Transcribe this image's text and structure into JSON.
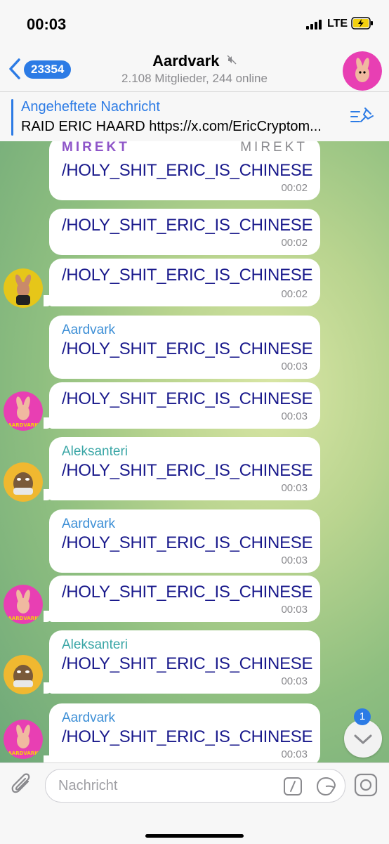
{
  "status_bar": {
    "time": "00:03",
    "network": "LTE"
  },
  "header": {
    "back_count": "23354",
    "title": "Aardvark",
    "subtitle": "2.108 Mitglieder, 244 online"
  },
  "pinned": {
    "title": "Angeheftete Nachricht",
    "text": "RAID ERIC HAARD https://x.com/EricCryptom..."
  },
  "messages": [
    {
      "sender_left": "MIREKT",
      "sender_right": "MIREKT",
      "text": "/HOLY_SHIT_ERIC_IS_CHINESE",
      "time": "00:02"
    },
    {
      "text": "/HOLY_SHIT_ERIC_IS_CHINESE",
      "time": "00:02"
    },
    {
      "text": "/HOLY_SHIT_ERIC_IS_CHINESE",
      "time": "00:02"
    },
    {
      "sender": "Aardvark",
      "text": "/HOLY_SHIT_ERIC_IS_CHINESE",
      "time": "00:03"
    },
    {
      "text": "/HOLY_SHIT_ERIC_IS_CHINESE",
      "time": "00:03"
    },
    {
      "sender": "Aleksanteri",
      "text": "/HOLY_SHIT_ERIC_IS_CHINESE",
      "time": "00:03"
    },
    {
      "sender": "Aardvark",
      "text": "/HOLY_SHIT_ERIC_IS_CHINESE",
      "time": "00:03"
    },
    {
      "text": "/HOLY_SHIT_ERIC_IS_CHINESE",
      "time": "00:03"
    },
    {
      "sender": "Aleksanteri",
      "text": "/HOLY_SHIT_ERIC_IS_CHINESE",
      "time": "00:03"
    },
    {
      "sender": "Aardvark",
      "text": "/HOLY_SHIT_ERIC_IS_CHINESE",
      "time": "00:03"
    }
  ],
  "avatar_label": "AARDVARK",
  "scroll_unread": "1",
  "composer": {
    "placeholder": "Nachricht"
  },
  "colors": {
    "accent": "#2c7be5",
    "sender_aardvark": "#3d8fd6",
    "sender_aleksanteri": "#3aa6a6",
    "sender_mirekt": "#8e55c8"
  }
}
